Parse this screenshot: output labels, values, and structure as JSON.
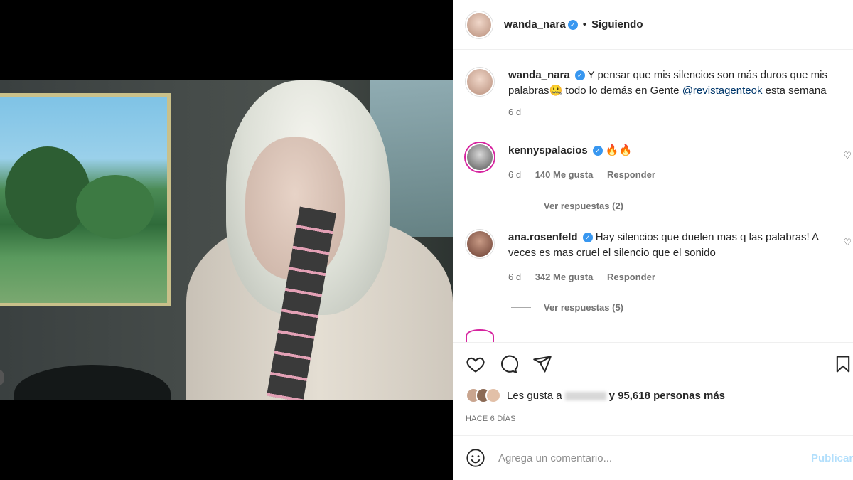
{
  "post": {
    "author": "wanda_nara",
    "follow_status": "Siguiendo",
    "separator": "•"
  },
  "caption": {
    "author": "wanda_nara",
    "text_1": "Y pensar que mis silencios son más duros que mis palabras",
    "emoji": "🤐",
    "text_2": " todo lo demás en Gente ",
    "mention": "@revistagenteok",
    "text_3": " esta semana",
    "time": "6 d"
  },
  "comments": [
    {
      "author": "kennyspalacios",
      "text": "🔥🔥",
      "time": "6 d",
      "likes": "140 Me gusta",
      "reply": "Responder",
      "view_replies": "Ver respuestas (2)"
    },
    {
      "author": "ana.rosenfeld",
      "text": "Hay silencios que duelen mas q las palabras! A veces es mas cruel el silencio que el sonido",
      "time": "6 d",
      "likes": "342 Me gusta",
      "reply": "Responder",
      "view_replies": "Ver respuestas (5)"
    }
  ],
  "likes": {
    "prefix": "Les gusta a",
    "suffix": "y 95,618 personas más"
  },
  "timestamp": "HACE 6 DÍAS",
  "add_comment": {
    "placeholder": "Agrega un comentario...",
    "publish": "Publicar"
  },
  "icons": {
    "like": "heart-icon",
    "comment": "comment-icon",
    "share": "share-icon",
    "save": "bookmark-icon",
    "emoji": "emoji-icon"
  }
}
